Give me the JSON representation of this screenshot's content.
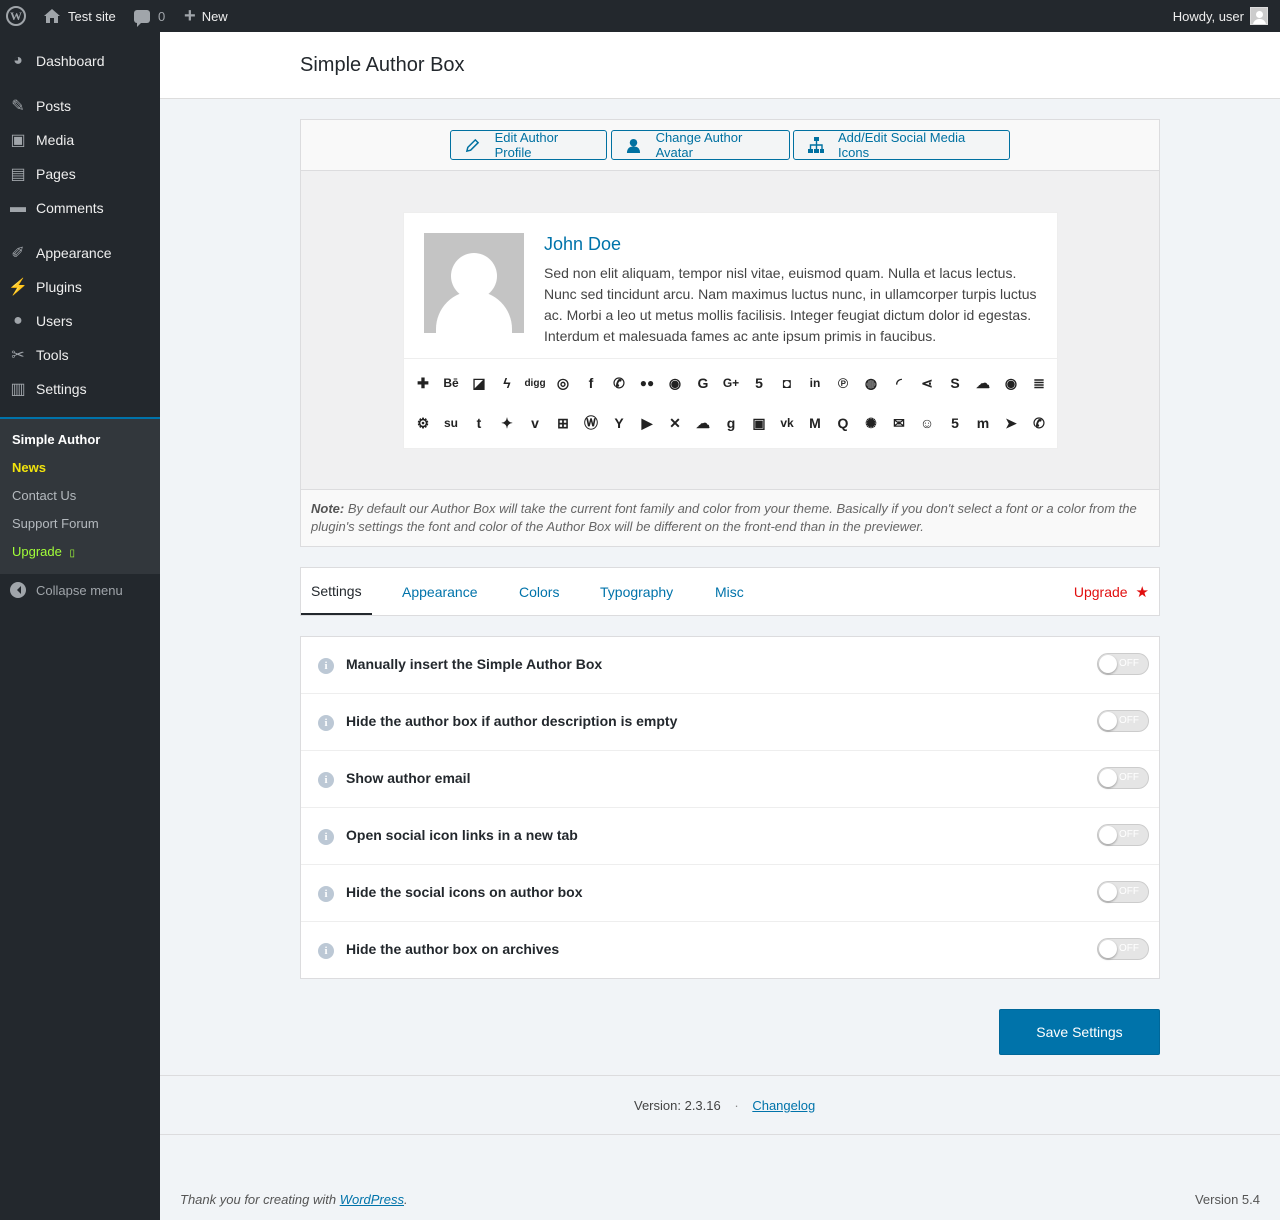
{
  "adminbar": {
    "site_name": "Test site",
    "comments_count": "0",
    "new_label": "New",
    "howdy": "Howdy, user"
  },
  "sidebar": {
    "items": [
      {
        "label": "Dashboard",
        "icon": "dashboard-icon"
      },
      {
        "label": "Posts",
        "icon": "pin-icon"
      },
      {
        "label": "Media",
        "icon": "media-icon"
      },
      {
        "label": "Pages",
        "icon": "pages-icon"
      },
      {
        "label": "Comments",
        "icon": "comment-icon"
      },
      {
        "label": "Appearance",
        "icon": "brush-icon"
      },
      {
        "label": "Plugins",
        "icon": "plug-icon"
      },
      {
        "label": "Users",
        "icon": "user-icon"
      },
      {
        "label": "Tools",
        "icon": "wrench-icon"
      },
      {
        "label": "Settings",
        "icon": "settings-icon"
      },
      {
        "label": "Simple Author",
        "icon": "hexagon-icon"
      }
    ],
    "submenu": [
      {
        "label": "Simple Author"
      },
      {
        "label": "News"
      },
      {
        "label": "Contact Us"
      },
      {
        "label": "Support Forum"
      },
      {
        "label": "Upgrade"
      }
    ],
    "collapse": "Collapse menu"
  },
  "page": {
    "title": "Simple Author Box"
  },
  "preview": {
    "buttons": [
      {
        "label": "Edit Author Profile",
        "icon": "pencil-icon"
      },
      {
        "label": "Change Author Avatar",
        "icon": "user-icon"
      },
      {
        "label": "Add/Edit Social Media Icons",
        "icon": "sitemap-icon"
      }
    ],
    "author_name": "John Doe",
    "author_description": "Sed non elit aliquam, tempor nisl vitae, euismod quam. Nulla et lacus lectus. Nunc sed tincidunt arcu. Nam maximus luctus nunc, in ullamcorper turpis luctus ac. Morbi a leo ut metus mollis facilisis. Integer feugiat dictum dolor id egestas. Interdum et malesuada fames ac ante ipsum primis in faucibus.",
    "social_icons_row1": [
      "addthis-icon",
      "behance-icon",
      "delicious-icon",
      "deviantart-icon",
      "digg-icon",
      "dribbble-icon",
      "facebook-icon",
      "whatsapp-icon",
      "flickr-icon",
      "github-icon",
      "google-icon",
      "googleplus-icon",
      "html5-icon",
      "instagram-icon",
      "linkedin-icon",
      "pinterest-icon",
      "reddit-icon",
      "rss-icon",
      "share-icon",
      "skype-icon",
      "soundcloud-icon",
      "spotify-icon",
      "stackoverflow-icon"
    ],
    "social_icons_row2": [
      "steam-icon",
      "stumbleupon-icon",
      "tumblr-icon",
      "twitter-icon",
      "vimeo-icon",
      "windows-icon",
      "wordpress-icon",
      "yahoo-icon",
      "youtube-icon",
      "xing-icon",
      "mixcloud-icon",
      "goodreads-icon",
      "twitch-icon",
      "vk-icon",
      "medium-icon",
      "quora-icon",
      "meetup-icon",
      "email-icon",
      "snapchat-icon",
      "500px-icon",
      "mastodon-icon",
      "telegram-icon",
      "phone-icon"
    ],
    "note_label": "Note:",
    "note_text": "By default our Author Box will take the current font family and color from your theme. Basically if you don't select a font or a color from the plugin's settings the font and color of the Author Box will be different on the front-end than in the previewer."
  },
  "tabs": {
    "items": [
      "Settings",
      "Appearance",
      "Colors",
      "Typography",
      "Misc"
    ],
    "upgrade": "Upgrade"
  },
  "settings": {
    "rows": [
      {
        "label": "Manually insert the Simple Author Box",
        "state": "OFF"
      },
      {
        "label": "Hide the author box if author description is empty",
        "state": "OFF"
      },
      {
        "label": "Show author email",
        "state": "OFF"
      },
      {
        "label": "Open social icon links in a new tab",
        "state": "OFF"
      },
      {
        "label": "Hide the social icons on author box",
        "state": "OFF"
      },
      {
        "label": "Hide the author box on archives",
        "state": "OFF"
      }
    ],
    "save_label": "Save Settings"
  },
  "version": {
    "label": "Version: 2.3.16",
    "separator": "·",
    "changelog": "Changelog"
  },
  "footer": {
    "thanks_prefix": "Thank you for creating with ",
    "wordpress_link": "WordPress",
    "thanks_suffix": ".",
    "wp_version": "Version 5.4"
  }
}
